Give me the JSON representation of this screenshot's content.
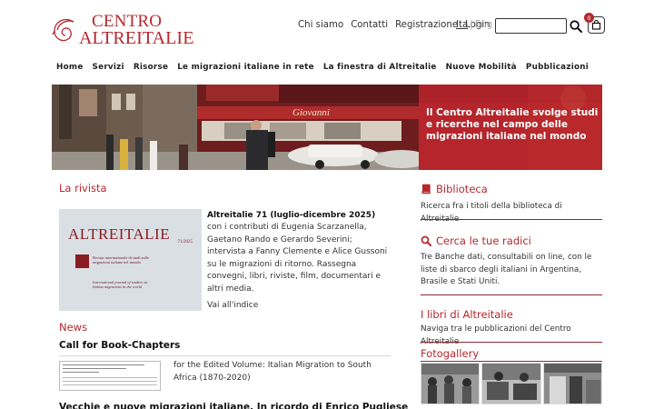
{
  "header": {
    "logo_line1": "CENTRO",
    "logo_line2": "ALTREITALIE",
    "topnav": [
      "Chi siamo",
      "Contatti",
      "Registrazione",
      "Login"
    ],
    "lang_it": "Ita",
    "lang_sep": "|",
    "lang_en": "Eng",
    "search_value": "",
    "cart_count": "0"
  },
  "mainnav": [
    "Home",
    "Servizi",
    "Risorse",
    "Le migrazioni italiane in rete",
    "La finestra di Altreitalie",
    "Nuove Mobilità",
    "Pubblicazioni"
  ],
  "hero": {
    "tagline": "Il Centro Altreitalie svolge studi e ricerche nel campo delle migrazioni italiane nel mondo",
    "shop_sign": "Giovanni"
  },
  "rivista": {
    "section_title": "La rivista",
    "cover_title": "ALTREITALIE",
    "cover_issue": "71/2025",
    "cover_text_it": "Rivista internazionale di studi sulle migrazioni italiane nel mondo",
    "cover_text_en": "International journal of studies on Italian migrations in the world",
    "issue_title": "Altreitalie 71 (luglio-dicembre 2025)",
    "issue_desc": "con i contributi di Eugenia Scarzanella, Gaetano Rando e Gerardo Severini; intervista a Fanny Clemente e Alice Gussoni su le migrazioni di ritorno. Rassegna convegni, libri, riviste, film, documentari e altri media.",
    "index_link": "Vai all'indice"
  },
  "news": {
    "section_title": "News",
    "item1_title": "Call for Book-Chapters",
    "item1_text": "for the Edited Volume: Italian Migration to South Africa (1870-2020)",
    "item2_title": "Vecchie e nuove migrazioni italiane. In ricordo di Enrico Pugliese"
  },
  "sidebar": {
    "biblioteca_title": "Biblioteca",
    "biblioteca_text": "Ricerca fra i titoli della biblioteca di Altreitalie",
    "radici_title": "Cerca le tue radici",
    "radici_text": "Tre Banche dati, consultabili on line, con le liste di sbarco degli italiani in Argentina, Brasile e Stati Uniti.",
    "libri_title": "I libri di Altreitalie",
    "libri_text": "Naviga tra le pubblicazioni del Centro Altreitalie",
    "gallery_title": "Fotogallery"
  },
  "colors": {
    "accent": "#b5282e",
    "hero_panel": "#b5252b"
  }
}
